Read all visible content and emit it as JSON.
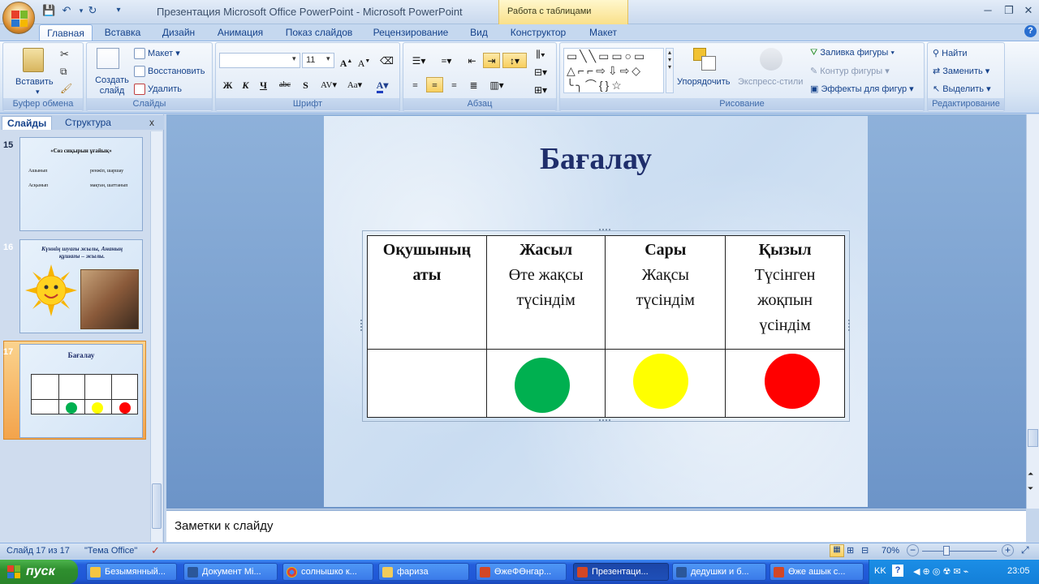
{
  "window": {
    "title": "Презентация Microsoft Office PowerPoint - Microsoft PowerPoint",
    "context_tab": "Работа с таблицами"
  },
  "tabs": [
    "Главная",
    "Вставка",
    "Дизайн",
    "Анимация",
    "Показ слайдов",
    "Рецензирование",
    "Вид",
    "Конструктор",
    "Макет"
  ],
  "ribbon": {
    "clipboard": {
      "label": "Буфер обмена",
      "paste": "Вставить"
    },
    "slides": {
      "label": "Слайды",
      "new_slide": "Создать слайд",
      "layout": "Макет",
      "reset": "Восстановить",
      "delete": "Удалить"
    },
    "font": {
      "label": "Шрифт",
      "font_name": "",
      "font_size": "11",
      "bold": "Ж",
      "italic": "К",
      "underline": "Ч",
      "strike": "abc",
      "shadow": "S",
      "spacing": "AV",
      "case": "Aa",
      "color": "A"
    },
    "paragraph": {
      "label": "Абзац"
    },
    "drawing": {
      "label": "Рисование",
      "arrange": "Упорядочить",
      "quick_styles": "Экспресс-стили",
      "fill": "Заливка фигуры",
      "outline": "Контур фигуры",
      "effects": "Эффекты для фигур"
    },
    "editing": {
      "label": "Редактирование",
      "find": "Найти",
      "replace": "Заменить",
      "select": "Выделить"
    }
  },
  "left_panel": {
    "tabs": [
      "Слайды",
      "Структура"
    ],
    "close": "x",
    "thumbnails": [
      {
        "num": "15",
        "title": "«Сөз сиқырын ұғайық»",
        "lines": [
          [
            "Ашынып",
            "ренжіп, шаршау"
          ],
          [
            "Асқынып",
            "мақтан, шаттанып"
          ]
        ]
      },
      {
        "num": "16",
        "title": "Күннің шуағы жылы, Ананың құшағы – жылы."
      },
      {
        "num": "17",
        "title": "Бағалау"
      }
    ]
  },
  "slide": {
    "title": "Бағалау",
    "table": {
      "headers": [
        {
          "bold": "Оқушының аты",
          "text": ""
        },
        {
          "bold": "Жасыл",
          "text": "Өте жақсы түсіндім"
        },
        {
          "bold": "Сары",
          "text": "Жақсы түсіндім"
        },
        {
          "bold": "Қызыл",
          "text": "Түсінген жоқпын үсіндім"
        }
      ],
      "circle_colors": [
        "#00b050",
        "#ffff00",
        "#ff0000"
      ]
    }
  },
  "notes": {
    "placeholder": "Заметки к слайду"
  },
  "status": {
    "slide_counter": "Слайд 17 из 17",
    "theme": "\"Тема Office\"",
    "zoom": "70%"
  },
  "taskbar": {
    "start": "пуск",
    "tasks": [
      "Безымянный...",
      "Документ Mi...",
      "солнышко к...",
      "фариза",
      "ӨжеФӨнгар...",
      "Презентаци...",
      "дедушки и б...",
      "Өже ашык с..."
    ],
    "lang": "KK",
    "clock": "23:05"
  }
}
